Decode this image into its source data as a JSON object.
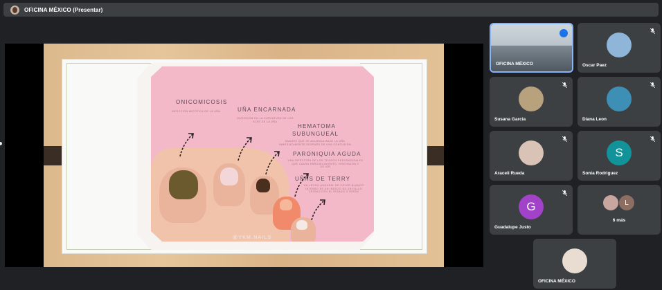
{
  "meeting": {
    "title": "OFICINA MÉXICO (Presentar)"
  },
  "slide": {
    "labels": {
      "onicomicosis": "ONICOMICOSIS",
      "una_encarnada": "UÑA ENCARNADA",
      "hematoma": "HEMATOMA",
      "subungueal": "SUBUNGUEAL",
      "paroniquia": "PARONIQUIA AGUDA",
      "unas_terry": "UÑAS DE TERRY"
    },
    "descriptions": {
      "onicomicosis": "INFECCIÓN MICÓTICA DE LA UÑA",
      "una_encarnada": "INVERSIÓN EN LA CURVATURA DE LOS EJES DE LA UÑA",
      "hematoma": "SANGRE QUE SE ACUMULA BAJO LA UÑA INMEDIATAMENTE DESPUÉS DE UNA CONTUSIÓN",
      "paroniquia": "UNA INFECCIÓN DE LOS TEJIDOS PERIUNGUEALES QUE CAUSA ENROJECIMIENTO, HINCHAZÓN Y DOLOR",
      "unas_terry": "UN LECHO UNGUEAL DE COLOR BLANCO INTENSO ES UN INDICIO DE UN FALLO CRÓNICO EN EL HÍGADO O RIÑÓN"
    },
    "brand": "@YKM.NAILS"
  },
  "participants": [
    {
      "name": "OFICINA MÉXICO",
      "type": "video",
      "speaking": true
    },
    {
      "name": "Oscar Paez",
      "type": "photo",
      "muted": true,
      "color": "#8fb5d9"
    },
    {
      "name": "Susana Garcia",
      "type": "photo",
      "muted": true,
      "color": "#b8a27e"
    },
    {
      "name": "Diana Leon",
      "type": "photo",
      "muted": true,
      "color": "#3e8fb5"
    },
    {
      "name": "Araceli Rueda",
      "type": "photo",
      "muted": true,
      "color": "#d9c2b6"
    },
    {
      "name": "Sonia Rodriguez",
      "type": "initial",
      "initial": "S",
      "muted": true,
      "color": "#12939a"
    },
    {
      "name": "Guadalupe Justo",
      "type": "initial",
      "initial": "G",
      "muted": true,
      "color": "#a142c8"
    },
    {
      "name": "6 más",
      "type": "more",
      "initial": "L",
      "color": "#8d6e63"
    },
    {
      "name": "OFICINA MÉXICO",
      "type": "photo",
      "muted": false,
      "color": "#e9ddd2"
    }
  ]
}
